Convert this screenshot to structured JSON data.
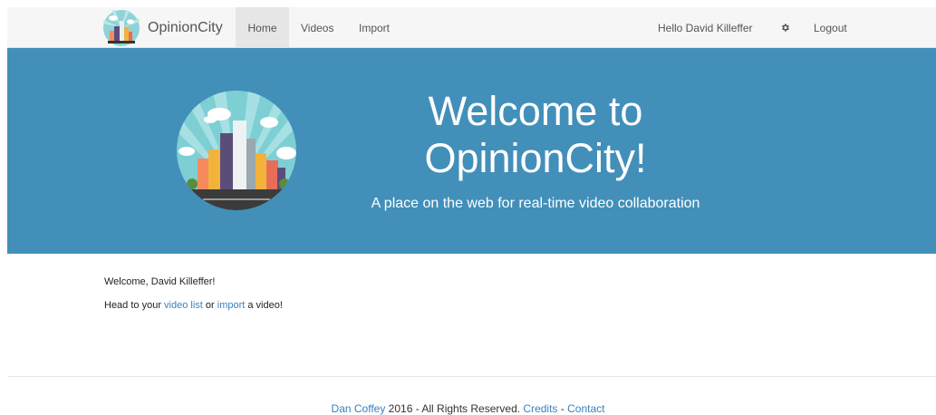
{
  "navbar": {
    "brand": "OpinionCity",
    "items": [
      {
        "label": "Home",
        "active": true
      },
      {
        "label": "Videos"
      },
      {
        "label": "Import"
      }
    ],
    "greeting": "Hello David Killeffer",
    "settings_icon": "gear-icon",
    "logout": "Logout",
    "active_color": "#e6e6e6"
  },
  "hero": {
    "title_line1": "Welcome to",
    "title_line2": "OpinionCity!",
    "subtitle": "A place on the web for real-time video collaboration",
    "background": "#428fba"
  },
  "main": {
    "welcome": "Welcome, David Killeffer!",
    "head_to": "Head to your ",
    "video_list_link": "video list",
    "or": " or ",
    "import_link": "import",
    "suffix": " a video!"
  },
  "footer": {
    "author_link": "Dan Coffey",
    "middle": " 2016 - All Rights Reserved. ",
    "credits_link": "Credits",
    "separator": " - ",
    "contact_link": "Contact"
  },
  "colors": {
    "link": "#3a7fc1",
    "hero_bg": "#428fba"
  }
}
